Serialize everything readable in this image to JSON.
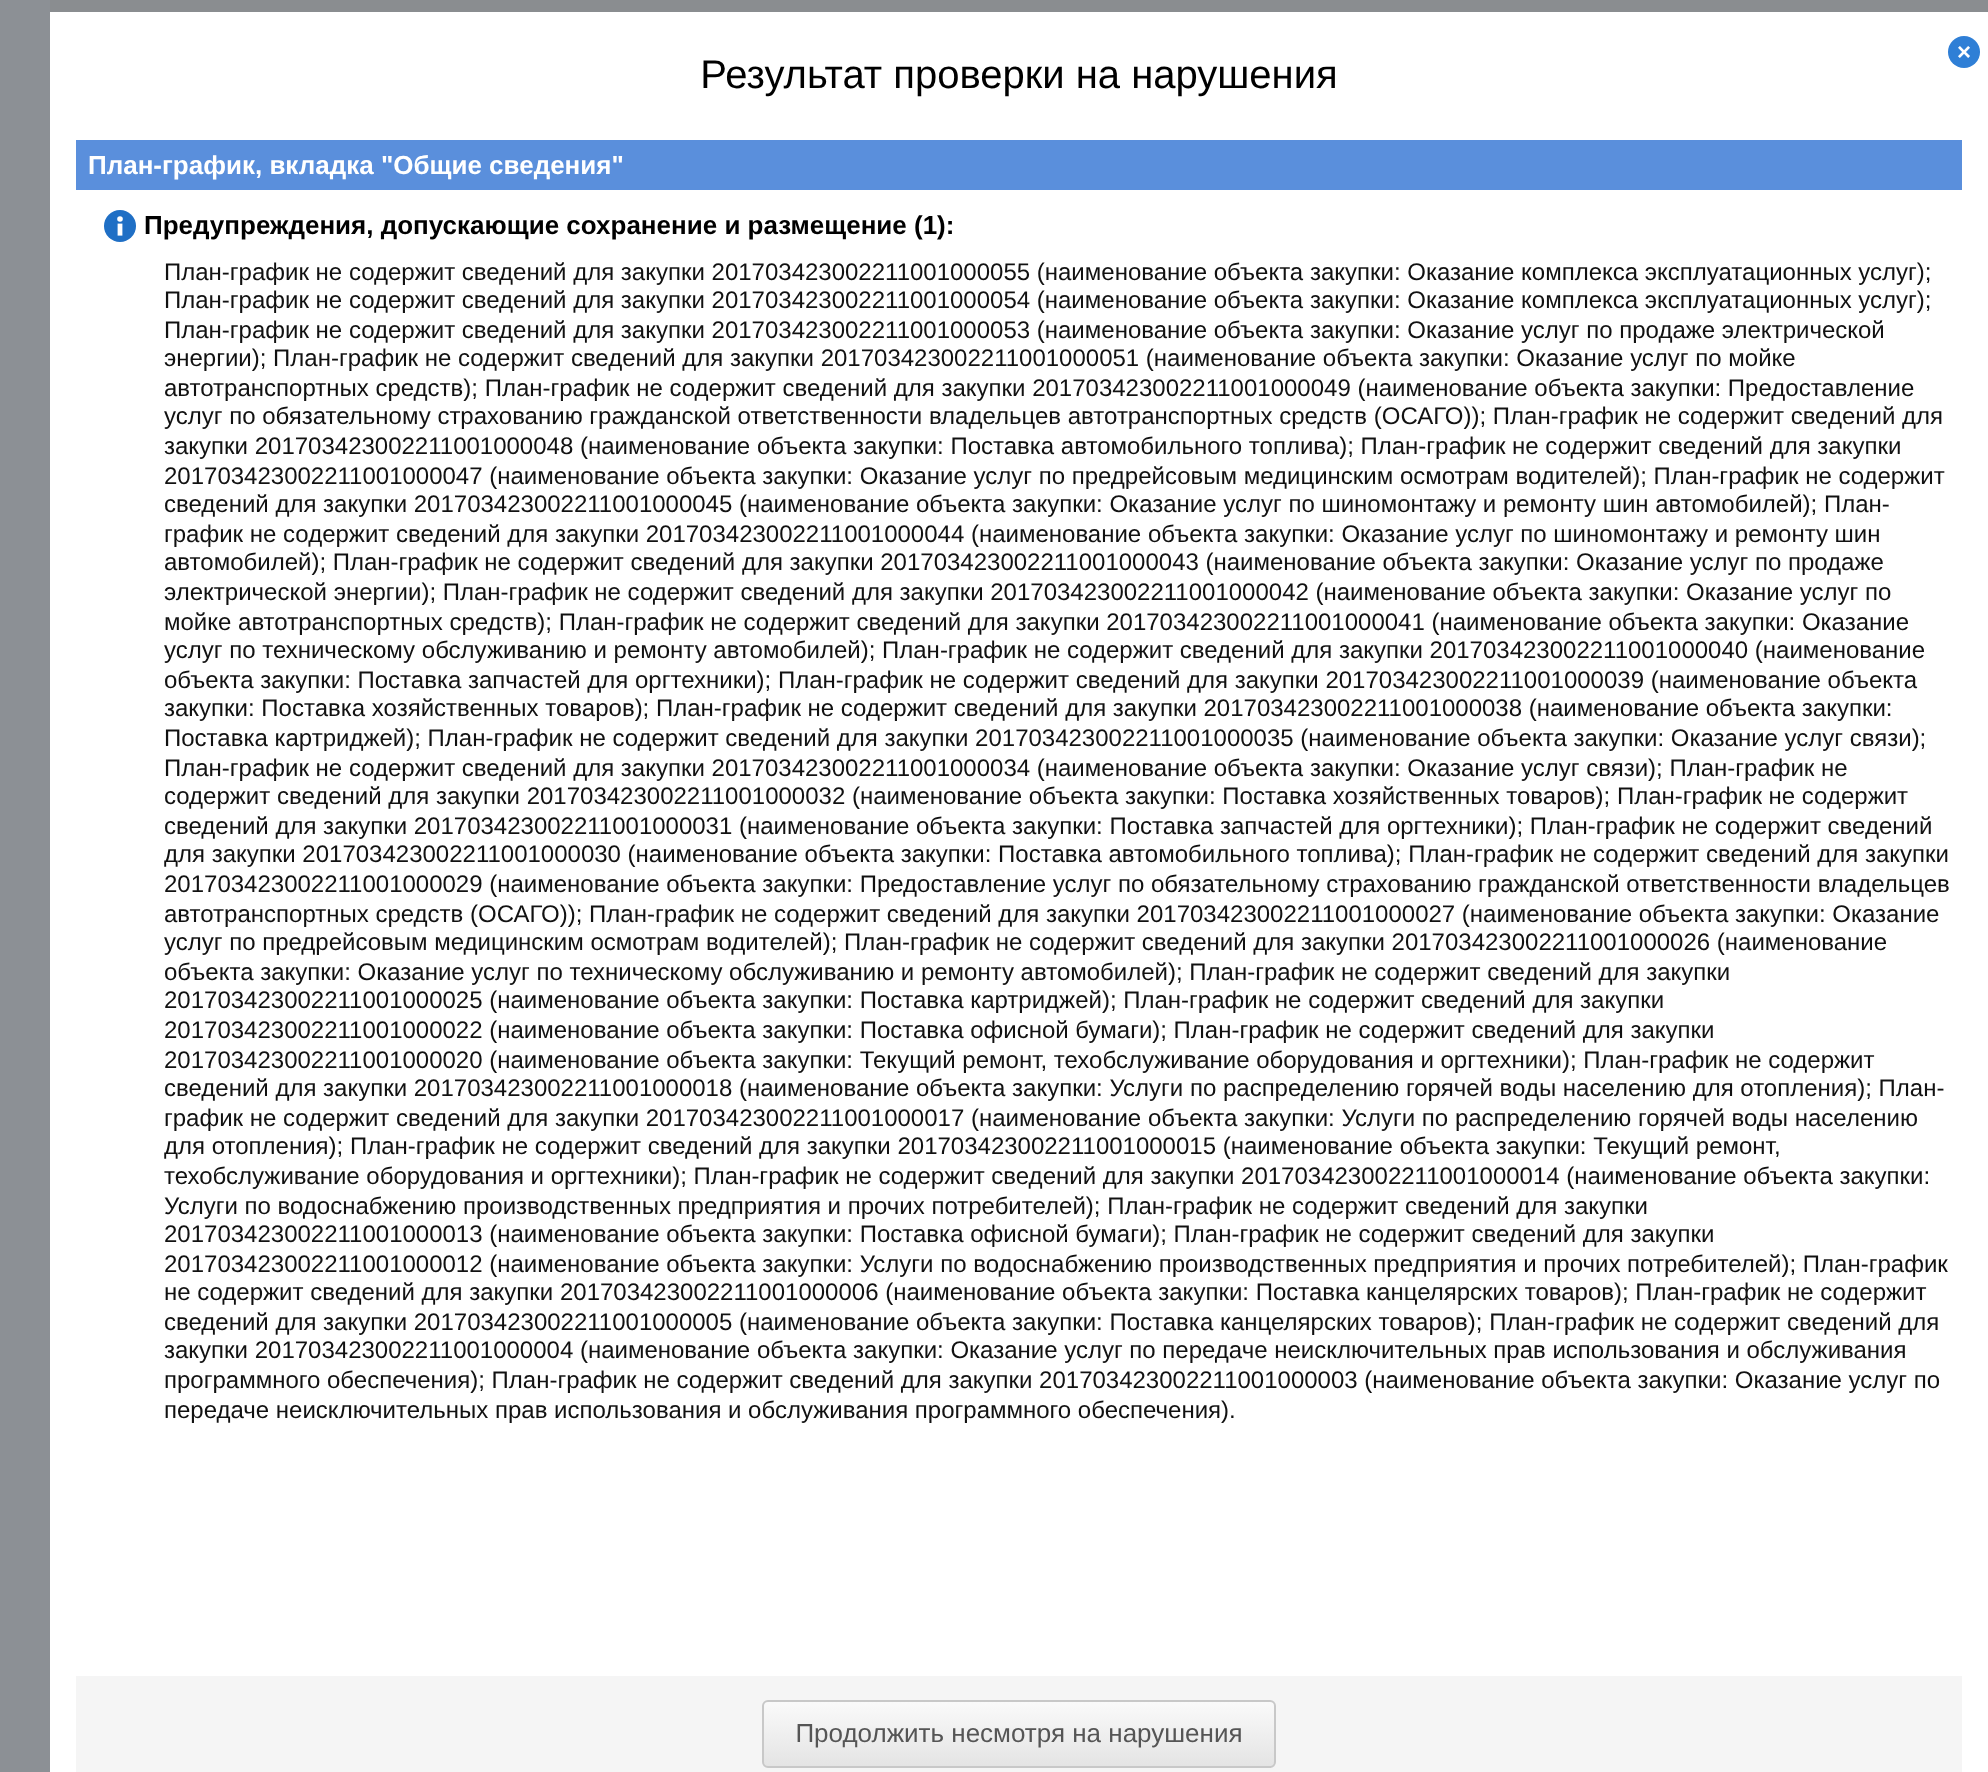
{
  "dialog": {
    "title": "Результат проверки на нарушения",
    "close": "×",
    "section": {
      "title": "План-график, вкладка \"Общие сведения\"",
      "warning_heading": "Предупреждения, допускающие сохранение и размещение (1):",
      "messages": [
        "План-график не содержит сведений для закупки 201703423002211001000055 (наименование объекта закупки: Оказание комплекса эксплуатационных услуг);",
        "План-график не содержит сведений для закупки 201703423002211001000054 (наименование объекта закупки: Оказание комплекса эксплуатационных услуг);",
        "План-график не содержит сведений для закупки 201703423002211001000053 (наименование объекта закупки: Оказание услуг по продаже электрической энергии);",
        "План-график не содержит сведений для закупки 201703423002211001000051 (наименование объекта закупки: Оказание услуг по мойке автотранспортных средств);",
        "План-график не содержит сведений для закупки 201703423002211001000049 (наименование объекта закупки: Предоставление услуг по обязательному страхованию гражданской ответственности владельцев автотранспортных средств (ОСАГО));",
        "План-график не содержит сведений для закупки 201703423002211001000048 (наименование объекта закупки: Поставка автомобильного топлива);",
        "План-график не содержит сведений для закупки 201703423002211001000047 (наименование объекта закупки: Оказание услуг по предрейсовым медицинским осмотрам водителей);",
        "План-график не содержит сведений для закупки 201703423002211001000045 (наименование объекта закупки: Оказание услуг по шиномонтажу и ремонту шин автомобилей);",
        "План-график не содержит сведений для закупки 201703423002211001000044 (наименование объекта закупки: Оказание услуг по шиномонтажу и ремонту шин автомобилей);",
        "План-график не содержит сведений для закупки 201703423002211001000043 (наименование объекта закупки: Оказание услуг по продаже электрической энергии);",
        "План-график не содержит сведений для закупки 201703423002211001000042 (наименование объекта закупки: Оказание услуг по мойке автотранспортных средств);",
        "План-график не содержит сведений для закупки 201703423002211001000041 (наименование объекта закупки: Оказание услуг по техническому обслуживанию и ремонту автомобилей);",
        "План-график не содержит сведений для закупки 201703423002211001000040 (наименование объекта закупки: Поставка запчастей для оргтехники);",
        "План-график не содержит сведений для закупки 201703423002211001000039 (наименование объекта закупки: Поставка хозяйственных товаров);",
        "План-график не содержит сведений для закупки 201703423002211001000038 (наименование объекта закупки: Поставка картриджей);",
        "План-график не содержит сведений для закупки 201703423002211001000035 (наименование объекта закупки: Оказание услуг связи);",
        "План-график не содержит сведений для закупки 201703423002211001000034 (наименование объекта закупки: Оказание услуг связи);",
        "План-график не содержит сведений для закупки 201703423002211001000032 (наименование объекта закупки: Поставка хозяйственных товаров);",
        "План-график не содержит сведений для закупки 201703423002211001000031 (наименование объекта закупки: Поставка запчастей для оргтехники);",
        "План-график не содержит сведений для закупки 201703423002211001000030 (наименование объекта закупки: Поставка автомобильного топлива);",
        "План-график не содержит сведений для закупки 201703423002211001000029 (наименование объекта закупки: Предоставление услуг по обязательному страхованию гражданской ответственности владельцев автотранспортных средств (ОСАГО));",
        "План-график не содержит сведений для закупки 201703423002211001000027 (наименование объекта закупки: Оказание услуг по предрейсовым медицинским осмотрам водителей);",
        "План-график не содержит сведений для закупки 201703423002211001000026 (наименование объекта закупки: Оказание услуг по техническому обслуживанию и ремонту автомобилей);",
        "План-график не содержит сведений для закупки 201703423002211001000025 (наименование объекта закупки: Поставка картриджей);",
        "План-график не содержит сведений для закупки 201703423002211001000022 (наименование объекта закупки: Поставка офисной бумаги);",
        "План-график не содержит сведений для закупки 201703423002211001000020 (наименование объекта закупки: Текущий ремонт, техобслуживание оборудования и оргтехники);",
        "План-график не содержит сведений для закупки 201703423002211001000018 (наименование объекта закупки: Услуги по распределению горячей воды населению для отопления);",
        "План-график не содержит сведений для закупки 201703423002211001000017 (наименование объекта закупки: Услуги по распределению горячей воды населению для отопления);",
        "План-график не содержит сведений для закупки 201703423002211001000015 (наименование объекта закупки: Текущий ремонт, техобслуживание оборудования и оргтехники);",
        "План-график не содержит сведений для закупки 201703423002211001000014 (наименование объекта закупки: Услуги по водоснабжению производственных предприятия и прочих потребителей);",
        "План-график не содержит сведений для закупки 201703423002211001000013 (наименование объекта закупки: Поставка офисной бумаги);",
        "План-график не содержит сведений для закупки 201703423002211001000012 (наименование объекта закупки: Услуги по водоснабжению производственных предприятия и прочих потребителей);",
        "План-график не содержит сведений для закупки 201703423002211001000006 (наименование объекта закупки: Поставка канцелярских товаров);",
        "План-график не содержит сведений для закупки 201703423002211001000005 (наименование объекта закупки: Поставка канцелярских товаров);",
        "План-график не содержит сведений для закупки 201703423002211001000004 (наименование объекта закупки: Оказание услуг по передаче неисключительных прав использования и обслуживания программного обеспечения);",
        "План-график не содержит сведений для закупки 201703423002211001000003 (наименование объекта закупки: Оказание услуг по передаче неисключительных прав использования и обслуживания программного обеспечения)."
      ]
    },
    "button": "Продолжить несмотря на нарушения"
  }
}
